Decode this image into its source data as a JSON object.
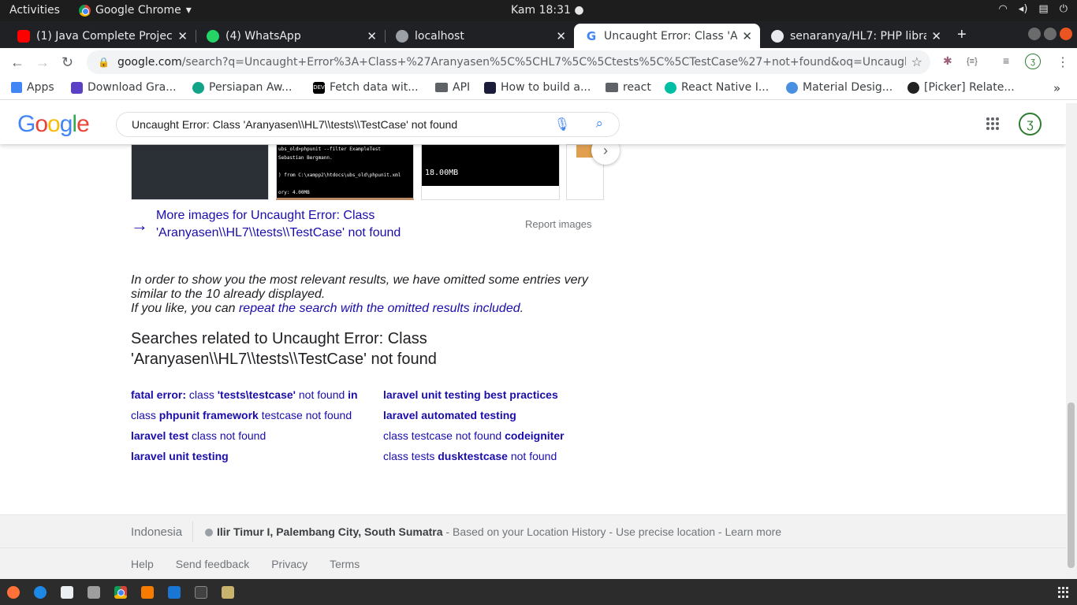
{
  "system": {
    "activities": "Activities",
    "app_name": "Google Chrome",
    "clock": "Kam 18:31 ●"
  },
  "tabs": [
    {
      "title": "(1) Java Complete Project",
      "favicon": "youtube-icon",
      "color": "#ff0000"
    },
    {
      "title": "(4) WhatsApp",
      "favicon": "whatsapp-icon",
      "color": "#25d366"
    },
    {
      "title": "localhost",
      "favicon": "globe-icon",
      "color": "#9aa0a6"
    },
    {
      "title": "Uncaught Error: Class 'Aranyasen",
      "favicon": "google-icon",
      "color": "#4285f4",
      "active": true
    },
    {
      "title": "senaranya/HL7: PHP library",
      "favicon": "github-icon",
      "color": "#e8eaed"
    }
  ],
  "address": {
    "host": "google.com",
    "path": "/search?q=Uncaught+Error%3A+Class+%27Aranyasen%5C%5CHL7%5C%5Ctests%5C%5CTestCase%27+not+found&oq=Uncaught+Error%3A+C..."
  },
  "bookmarks": [
    {
      "label": "Apps",
      "icon": "apps-grid-icon"
    },
    {
      "label": "Download Gra...",
      "icon": "shield-icon"
    },
    {
      "label": "Persiapan Aw...",
      "icon": "compass-icon"
    },
    {
      "label": "Fetch data wit...",
      "icon": "dev-icon"
    },
    {
      "label": "API",
      "icon": "folder-icon"
    },
    {
      "label": "How to build a...",
      "icon": "code-icon"
    },
    {
      "label": "react",
      "icon": "folder-icon"
    },
    {
      "label": "React Native I...",
      "icon": "react-icon"
    },
    {
      "label": "Material Desig...",
      "icon": "material-icon"
    },
    {
      "label": "[Picker] Relate...",
      "icon": "github-icon"
    }
  ],
  "search": {
    "query": "Uncaught Error: Class 'Aranyasen\\\\HL7\\\\tests\\\\TestCase' not found"
  },
  "images": {
    "thumb2_text": "ubs_old>phpunit --filter ExampleTest\nSebastian Bergmann.\n\n) from C:\\xampp2\\htdocs\\ubs_old\\phpunit.xml\n\nory: 4.00MB\n\nsts executed!\nubs_old>",
    "thumb3_text": "18.00MB",
    "more_link": "More images for Uncaught Error: Class 'Aranyasen\\\\HL7\\\\tests\\\\TestCase' not found",
    "report": "Report images"
  },
  "omitted": {
    "line1": "In order to show you the most relevant results, we have omitted some entries very similar to the 10 already displayed.",
    "line2_prefix": "If you like, you can ",
    "link": "repeat the search with the omitted results included",
    "suffix": "."
  },
  "related": {
    "heading": "Searches related to Uncaught Error: Class 'Aranyasen\\\\HL7\\\\tests\\\\TestCase' not found",
    "items": [
      [
        "fatal error:",
        " class ",
        "'tests\\testcase'",
        " not found ",
        "in"
      ],
      [
        "laravel unit testing best practices"
      ],
      [
        "class ",
        "phpunit framework",
        " testcase not found"
      ],
      [
        "laravel automated testing"
      ],
      [
        "laravel test",
        " class not found"
      ],
      [
        "class testcase not found ",
        "codeigniter"
      ],
      [
        "laravel unit testing"
      ],
      [
        "class tests ",
        "dusktestcase",
        " not found"
      ]
    ]
  },
  "footer": {
    "country": "Indonesia",
    "location_bold": "Ilir Timur I, Palembang City, South Sumatra",
    "location_rest": " - Based on your Location History - Use precise location - Learn more",
    "links": [
      "Help",
      "Send feedback",
      "Privacy",
      "Terms"
    ]
  }
}
